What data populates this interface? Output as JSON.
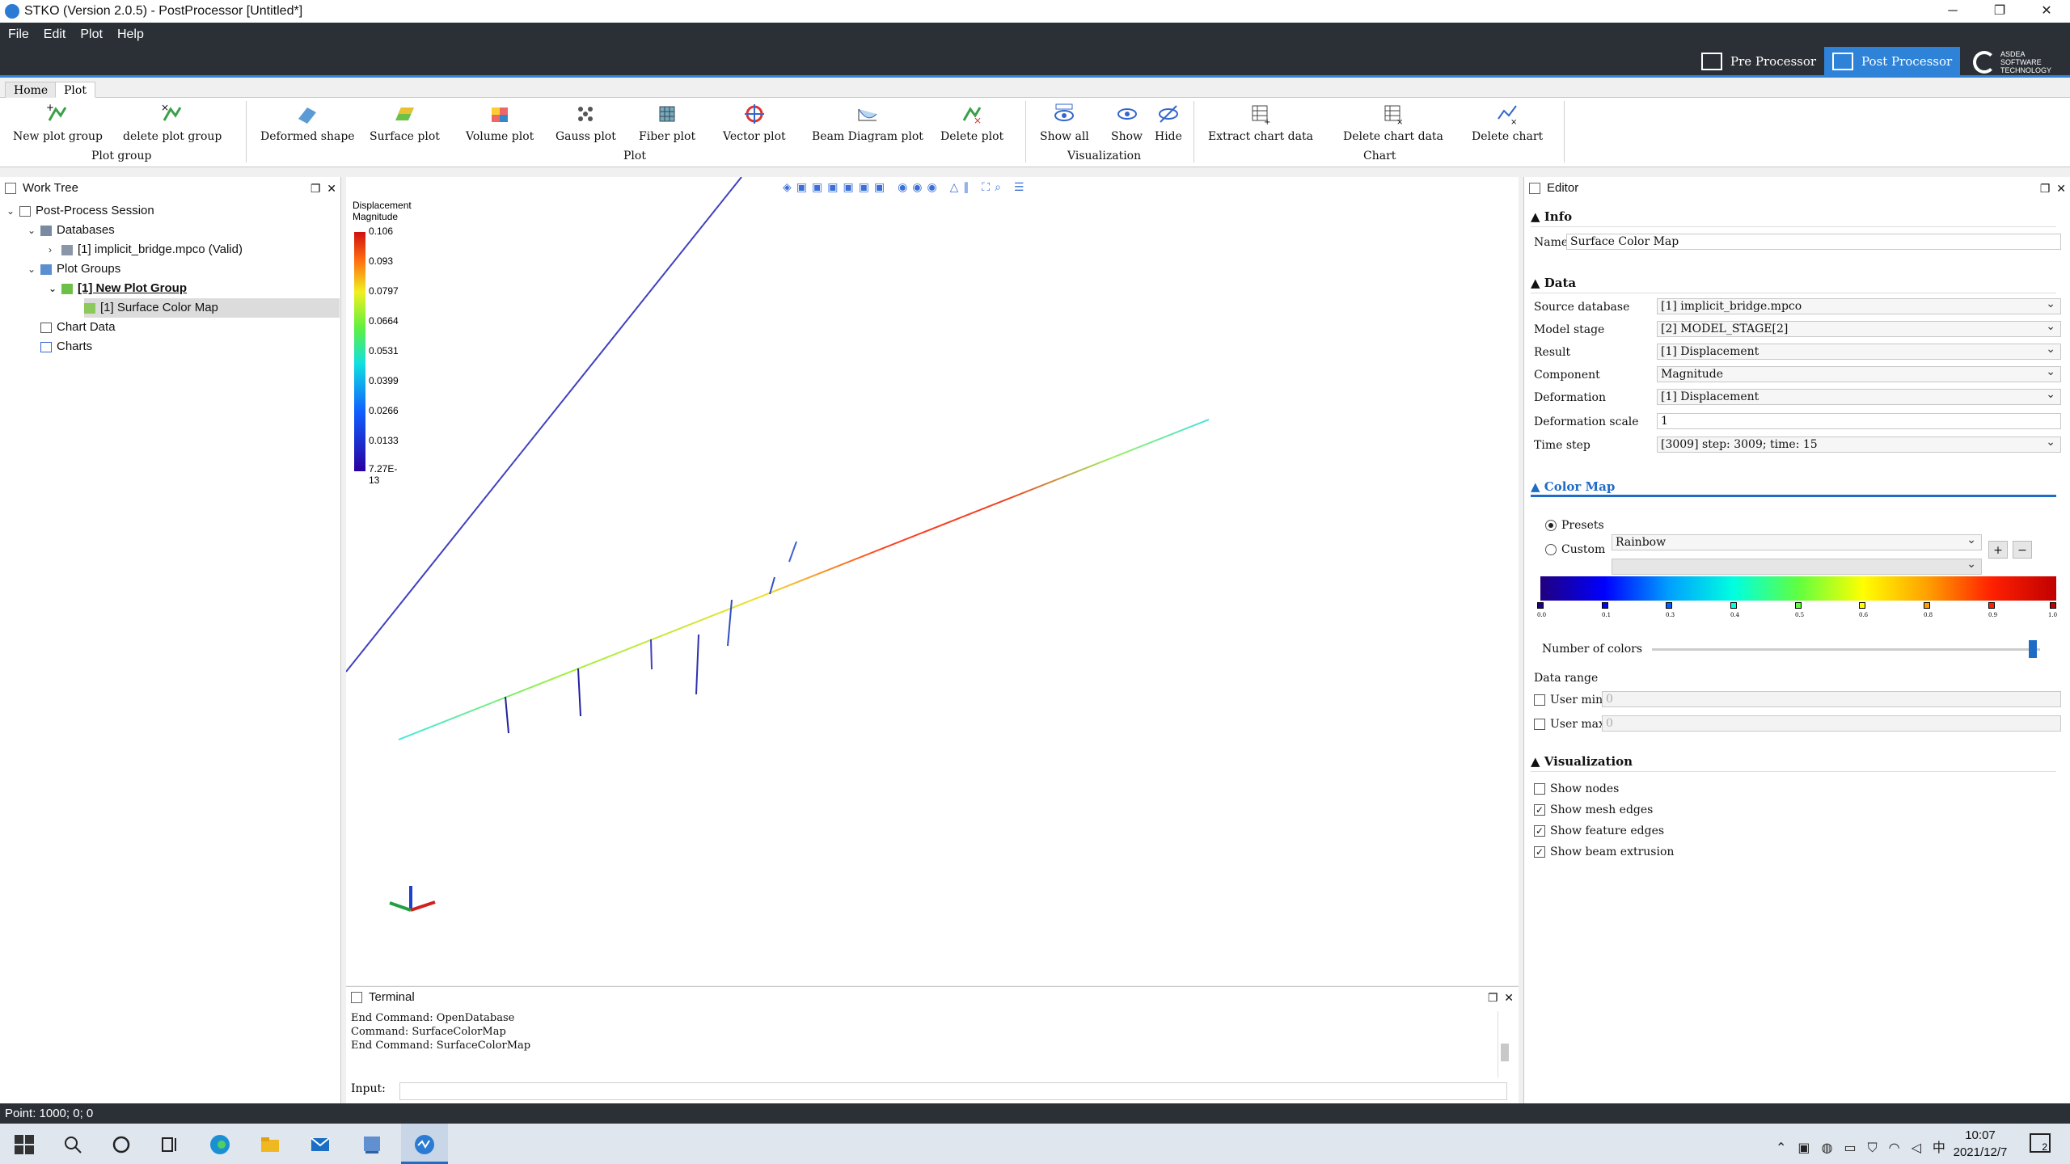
{
  "window": {
    "title": "STKO (Version 2.0.5) - PostProcessor [Untitled*]",
    "minimize": "─",
    "maximize": "❐",
    "close": "✕"
  },
  "menu": [
    "File",
    "Edit",
    "Plot",
    "Help"
  ],
  "modes": {
    "pre": "Pre Processor",
    "post": "Post Processor",
    "brand": "ASDEA SOFTWARE TECHNOLOGY"
  },
  "ribbon": {
    "tabs": [
      "Home",
      "Plot"
    ],
    "buttons": {
      "new_plot_group": "New plot group",
      "delete_plot_group": "delete plot group",
      "deformed_shape": "Deformed shape",
      "surface_plot": "Surface plot",
      "volume_plot": "Volume plot",
      "gauss_plot": "Gauss plot",
      "fiber_plot": "Fiber plot",
      "vector_plot": "Vector plot",
      "beam_diagram_plot": "Beam Diagram plot",
      "delete_plot": "Delete plot",
      "show_all": "Show all",
      "show": "Show",
      "hide": "Hide",
      "extract_chart_data": "Extract chart data",
      "delete_chart_data": "Delete chart data",
      "delete_chart": "Delete chart"
    },
    "groups": {
      "plot_group": "Plot group",
      "plot": "Plot",
      "visualization": "Visualization",
      "chart": "Chart"
    }
  },
  "worktree": {
    "title": "Work Tree",
    "items": {
      "session": "Post-Process Session",
      "databases": "Databases",
      "db1": "[1] implicit_bridge.mpco (Valid)",
      "plot_groups": "Plot Groups",
      "group1": "[1] New Plot Group",
      "plot1": "[1] Surface Color Map",
      "chart_data": "Chart Data",
      "charts": "Charts"
    }
  },
  "viewport": {
    "legend_title_1": "Displacement",
    "legend_title_2": "Magnitude",
    "legend_ticks": [
      "0.106",
      "0.093",
      "0.0797",
      "0.0664",
      "0.0531",
      "0.0399",
      "0.0266",
      "0.0133",
      "7.27E-13"
    ]
  },
  "terminal": {
    "title": "Terminal",
    "lines": [
      "End Command: OpenDatabase",
      "Command: SurfaceColorMap",
      "End Command: SurfaceColorMap"
    ],
    "input_label": "Input:"
  },
  "editor": {
    "title": "Editor",
    "info": {
      "section": "Info",
      "name_label": "Name",
      "name_value": "Surface Color Map"
    },
    "data": {
      "section": "Data",
      "source_database_label": "Source database",
      "source_database": "[1] implicit_bridge.mpco",
      "model_stage_label": "Model stage",
      "model_stage": "[2] MODEL_STAGE[2]",
      "result_label": "Result",
      "result": "[1] Displacement",
      "component_label": "Component",
      "component": "Magnitude",
      "deformation_label": "Deformation",
      "deformation": "[1] Displacement",
      "deformation_scale_label": "Deformation scale",
      "deformation_scale": "1",
      "time_step_label": "Time step",
      "time_step": "[3009] step: 3009; time: 15"
    },
    "color_map": {
      "section": "Color Map",
      "presets_label": "Presets",
      "presets_value": "Rainbow",
      "custom_label": "Custom",
      "stops": [
        "0.0",
        "0.1",
        "0.3",
        "0.4",
        "0.5",
        "0.6",
        "0.8",
        "0.9",
        "1.0"
      ],
      "number_of_colors_label": "Number of colors",
      "data_range_label": "Data range",
      "user_min_label": "User min",
      "user_min": "0",
      "user_max_label": "User max",
      "user_max": "0"
    },
    "visualization": {
      "section": "Visualization",
      "show_nodes": "Show nodes",
      "show_mesh_edges": "Show mesh edges",
      "show_feature_edges": "Show feature edges",
      "show_beam_extrusion": "Show beam extrusion"
    }
  },
  "status": {
    "point": "Point: 1000; 0; 0"
  },
  "taskbar": {
    "time": "10:07",
    "date": "2021/12/7",
    "ime": "中",
    "notifications": "2"
  }
}
